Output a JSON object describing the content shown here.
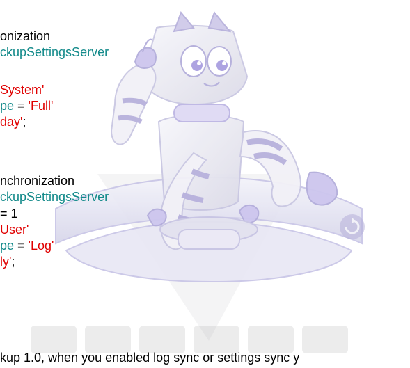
{
  "lines": [
    {
      "a": "onization"
    },
    {
      "a": "ckupSettingsServer"
    },
    {
      "a": "System'"
    },
    {
      "a": "pe",
      "b": " = ",
      "c": "'Full'"
    },
    {
      "a": "day'",
      "b": ";"
    },
    {
      "a": "nchronization"
    },
    {
      "a": "ckupSettingsServer"
    },
    {
      "a": "= 1"
    },
    {
      "a": "User'"
    },
    {
      "a": "pe",
      "b": " = ",
      "c": "'Log'"
    },
    {
      "a": "ly'",
      "b": ";"
    }
  ],
  "footer_text": "kup 1.0, when you enabled log sync or settings sync y",
  "watermark": {
    "depicts": "robot-mascot",
    "colors": {
      "body": "#e7e7ef",
      "accent": "#cdc6ee",
      "outline": "#b8b2da",
      "dish": "#d9d8ea"
    }
  },
  "colors": {
    "keyword": "#000000",
    "identifier": "#138a8a",
    "string": "#e00000",
    "operator": "#7f7f7f"
  }
}
